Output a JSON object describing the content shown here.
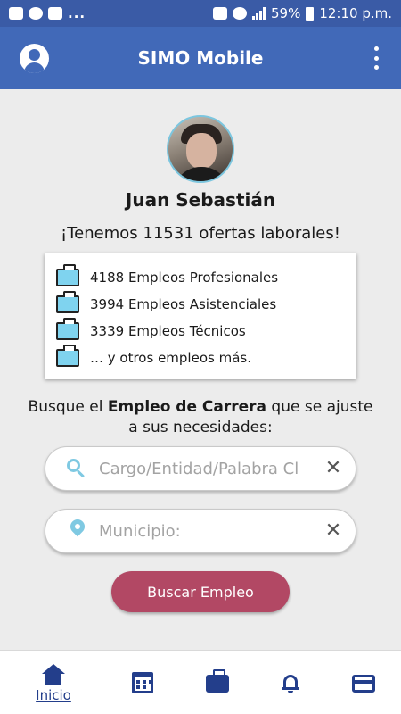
{
  "status_bar": {
    "notifications": [
      "mail-icon",
      "pinterest-icon",
      "youtube-icon"
    ],
    "more": "...",
    "battery": "59%",
    "time": "12:10 p.m."
  },
  "appbar": {
    "title": "SIMO Mobile"
  },
  "profile": {
    "name": "Juan Sebastián",
    "offers_message": "¡Tenemos 11531 ofertas laborales!"
  },
  "jobs": [
    {
      "label": "4188 Empleos Profesionales"
    },
    {
      "label": "3994 Empleos Asistenciales"
    },
    {
      "label": "3339 Empleos Técnicos"
    },
    {
      "label": "… y otros empleos más."
    }
  ],
  "search_prompt": {
    "before": "Busque el ",
    "bold": "Empleo de Carrera",
    "after": " que se ajuste a sus necesidades:"
  },
  "search_field": {
    "placeholder": "Cargo/Entidad/Palabra Cl",
    "value": ""
  },
  "municipio_field": {
    "placeholder": "Municipio:",
    "value": ""
  },
  "search_button": {
    "label": "Buscar Empleo"
  },
  "bottom_nav": {
    "home_label": "Inicio",
    "items": [
      "home-icon",
      "calendar-icon",
      "briefcase-icon",
      "bell-icon",
      "credit-card-icon"
    ]
  },
  "colors": {
    "appbar": "#4169b8",
    "statusbar": "#3a5ba6",
    "accent_icon": "#7fc9e2",
    "button": "#b24864",
    "nav_icon": "#233e8b",
    "background": "#ececec"
  }
}
